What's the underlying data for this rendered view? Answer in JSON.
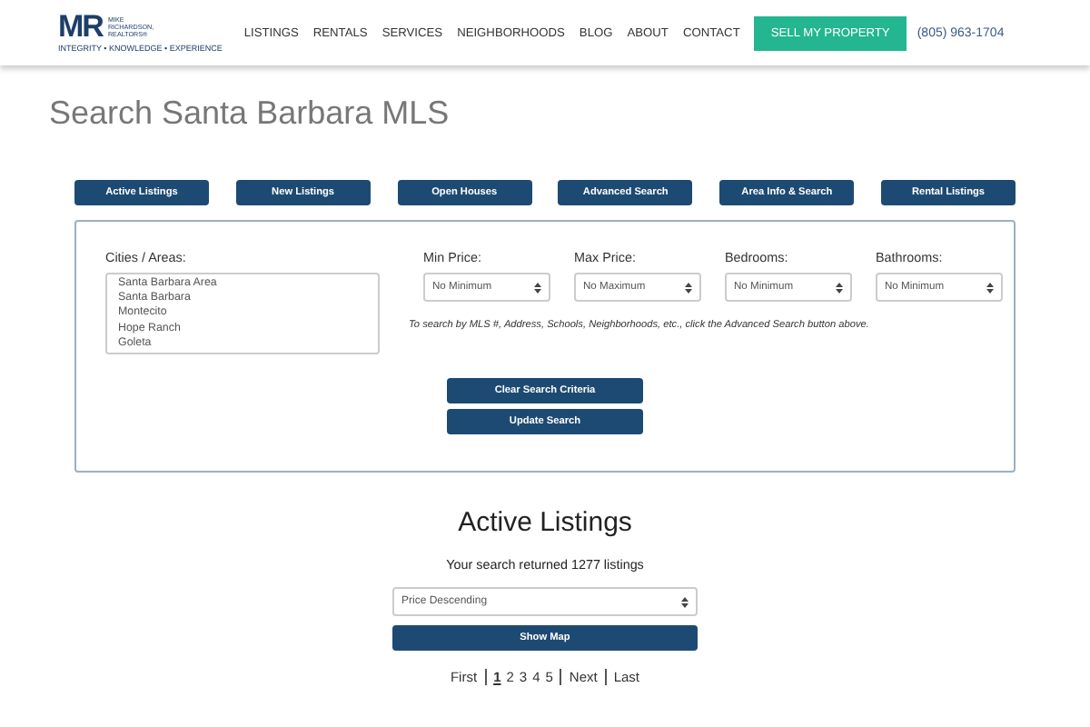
{
  "header": {
    "logo": {
      "letters": "MR",
      "name_lines": [
        "MIKE",
        "RICHARDSON,",
        "REALTORS®"
      ],
      "tagline": "INTEGRITY • KNOWLEDGE • EXPERIENCE"
    },
    "nav": [
      "LISTINGS",
      "RENTALS",
      "SERVICES",
      "NEIGHBORHOODS",
      "BLOG",
      "ABOUT",
      "CONTACT"
    ],
    "cta": "SELL MY PROPERTY",
    "phone": "(805) 963-1704"
  },
  "title": "Search Santa Barbara MLS",
  "tabs": [
    "Active Listings",
    "New Listings",
    "Open Houses",
    "Advanced Search",
    "Area Info & Search",
    "Rental Listings"
  ],
  "search": {
    "cities": {
      "label": "Cities / Areas:",
      "options": [
        "Santa Barbara Area",
        "Santa Barbara",
        "Montecito",
        "Hope Ranch",
        "Goleta"
      ]
    },
    "filters": [
      {
        "label": "Min Price:",
        "value": "No Minimum"
      },
      {
        "label": "Max Price:",
        "value": "No Maximum"
      },
      {
        "label": "Bedrooms:",
        "value": "No Minimum"
      },
      {
        "label": "Bathrooms:",
        "value": "No Minimum"
      }
    ],
    "hint": "To search by MLS #, Address, Schools, Neighborhoods, etc., click the Advanced Search button above.",
    "buttons": [
      "Clear Search Criteria",
      "Update Search"
    ]
  },
  "results": {
    "heading": "Active Listings",
    "summary": "Your search returned 1277 listings",
    "sort": "Price Descending",
    "map_button": "Show Map",
    "pagination": [
      {
        "label": "First",
        "kind": "nav",
        "selected": false
      },
      {
        "label": "1",
        "kind": "page",
        "selected": true
      },
      {
        "label": "2",
        "kind": "page",
        "selected": false
      },
      {
        "label": "3",
        "kind": "page",
        "selected": false
      },
      {
        "label": "4",
        "kind": "page",
        "selected": false
      },
      {
        "label": "5",
        "kind": "page",
        "selected": false
      },
      {
        "label": "Next",
        "kind": "nav",
        "selected": false
      },
      {
        "label": "Last",
        "kind": "nav",
        "selected": false
      }
    ]
  }
}
